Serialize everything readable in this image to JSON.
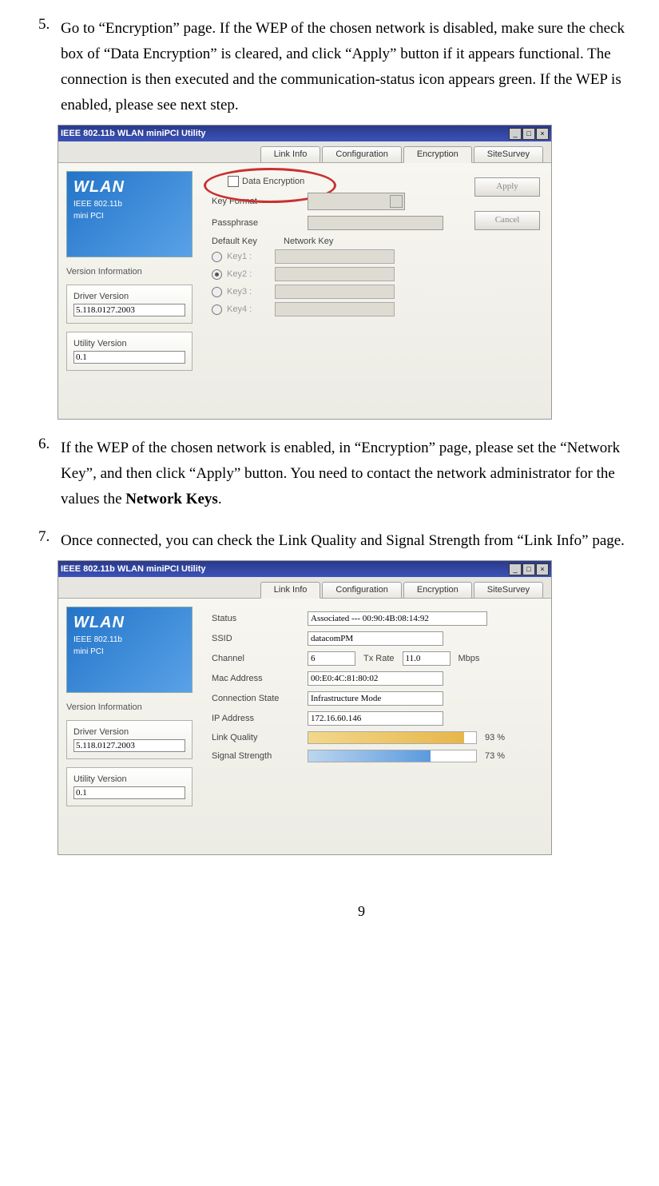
{
  "step5": {
    "num": "5.",
    "text": "Go to “Encryption” page.  If the WEP of the chosen network is disabled, make sure the check box of “Data Encryption” is cleared, and click “Apply” button if it appears functional.  The connection is then executed and the communication-status icon appears green.  If the WEP is enabled, please see next step."
  },
  "step6": {
    "num": "6.",
    "text_a": "If the WEP of the chosen network is enabled, in “Encryption” page, please set the “Network Key”, and then click “Apply” button.    You need to contact the network administrator for the values the ",
    "bold": "Network Keys",
    "text_b": "."
  },
  "step7": {
    "num": "7.",
    "text": "Once connected, you can check the Link Quality and Signal Strength from “Link Info” page."
  },
  "window_title": "IEEE 802.11b WLAN miniPCI Utility",
  "tabs": {
    "link": "Link Info",
    "config": "Configuration",
    "enc": "Encryption",
    "site": "SiteSurvey"
  },
  "brand": {
    "name": "WLAN",
    "sub1": "IEEE 802.11b",
    "sub2": "mini PCI"
  },
  "sidebar": {
    "version_info": "Version Information",
    "driver_label": "Driver Version",
    "driver_val": "5.118.0127.2003",
    "util_label": "Utility Version",
    "util_val": "0.1"
  },
  "enc": {
    "data_encryption": "Data Encryption",
    "key_format": "Key Format",
    "passphrase": "Passphrase",
    "default_key": "Default Key",
    "network_key": "Network Key",
    "key1": "Key1 :",
    "key2": "Key2 :",
    "key3": "Key3 :",
    "key4": "Key4 :",
    "apply": "Apply",
    "cancel": "Cancel"
  },
  "link": {
    "status_l": "Status",
    "status_v": "Associated --- 00:90:4B:08:14:92",
    "ssid_l": "SSID",
    "ssid_v": "datacomPM",
    "chan_l": "Channel",
    "chan_v": "6",
    "txrate_l": "Tx Rate",
    "txrate_v": "11.0",
    "mbps": "Mbps",
    "mac_l": "Mac Address",
    "mac_v": "00:E0:4C:81:80:02",
    "conn_l": "Connection State",
    "conn_v": "Infrastructure Mode",
    "ip_l": "IP Address",
    "ip_v": "172.16.60.146",
    "lq_l": "Link Quality",
    "lq_pct": "93 %",
    "lq_w": "93%",
    "ss_l": "Signal Strength",
    "ss_pct": "73 %",
    "ss_w": "73%"
  },
  "page_number": "9"
}
